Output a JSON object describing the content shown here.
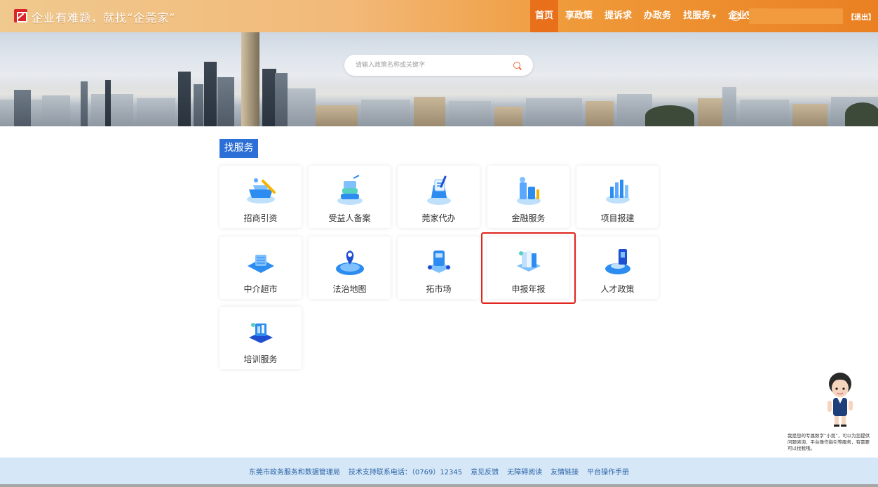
{
  "header": {
    "slogan": "企业有难题，就找“企莞家”",
    "nav": [
      {
        "label": "首页",
        "active": true
      },
      {
        "label": "享政策",
        "active": false
      },
      {
        "label": "提诉求",
        "active": false
      },
      {
        "label": "办政务",
        "active": false
      },
      {
        "label": "找服务",
        "active": false,
        "dropdown": true
      },
      {
        "label": "企业空间",
        "active": false
      }
    ],
    "user_icon": "user-icon",
    "user_initial": "(",
    "logout_label": "【退出】"
  },
  "search": {
    "placeholder": "请输入政策名称或关键字",
    "icon": "search-icon"
  },
  "section": {
    "title": "找服务"
  },
  "services": [
    {
      "label": "招商引资",
      "icon": "investment-icon"
    },
    {
      "label": "受益人备案",
      "icon": "beneficiary-filing-icon"
    },
    {
      "label": "莞家代办",
      "icon": "agency-service-icon"
    },
    {
      "label": "金融服务",
      "icon": "finance-icon"
    },
    {
      "label": "项目报建",
      "icon": "project-report-icon"
    },
    {
      "label": "中介超市",
      "icon": "intermediary-market-icon"
    },
    {
      "label": "法治地图",
      "icon": "legal-map-icon"
    },
    {
      "label": "拓市场",
      "icon": "market-expansion-icon"
    },
    {
      "label": "申报年报",
      "icon": "annual-report-icon",
      "highlighted": true
    },
    {
      "label": "人才政策",
      "icon": "talent-policy-icon"
    },
    {
      "label": "培训服务",
      "icon": "training-icon"
    }
  ],
  "assistant": {
    "text": "我是您的专属数字“小莞”，可以为您提供问题咨询、平台操作指引等服务，有需要可以找我哦。",
    "icon": "assistant-avatar-icon"
  },
  "footer": {
    "links": [
      "东莞市政务服务和数据管理局",
      "技术支持联系电话：（0769）12345",
      "意见反馈",
      "无障碍阅读",
      "友情链接",
      "平台操作手册"
    ]
  },
  "colors": {
    "accent_orange": "#ea8022",
    "section_blue": "#2c6fd6",
    "highlight_red": "#e0251d",
    "footer_bg": "#d6e8f7"
  }
}
